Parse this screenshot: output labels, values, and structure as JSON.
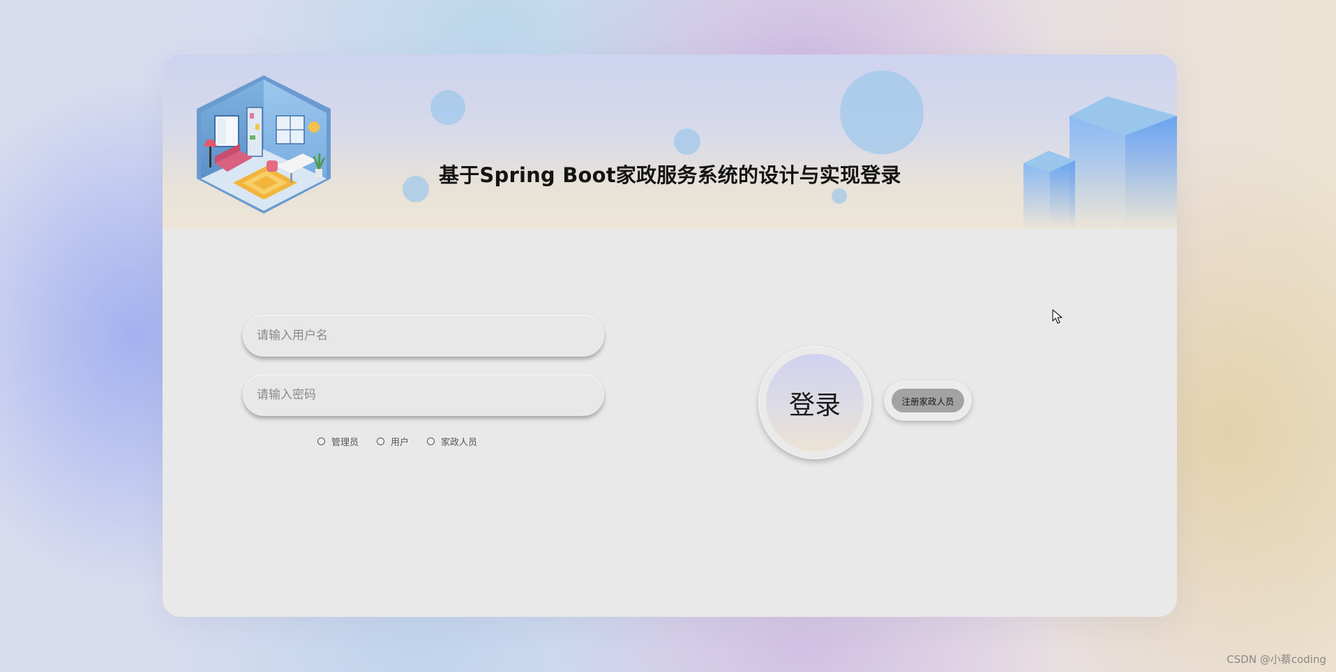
{
  "header": {
    "title": "基于Spring Boot家政服务系统的设计与实现登录"
  },
  "form": {
    "username_placeholder": "请输入用户名",
    "username_value": "",
    "password_placeholder": "请输入密码",
    "password_value": "",
    "roles": [
      {
        "label": "管理员",
        "selected": false
      },
      {
        "label": "用户",
        "selected": false
      },
      {
        "label": "家政人员",
        "selected": false
      }
    ]
  },
  "actions": {
    "login_label": "登录",
    "register_label": "注册家政人员"
  },
  "watermark": "CSDN @小蔡coding",
  "colors": {
    "card_background": "#e9e9e9",
    "register_button": "#a3a3a3",
    "bubble": "#a0c8eb",
    "cube_blue": "#6fa8ee"
  },
  "icons": {
    "illustration": "isometric-room-illustration",
    "decoration": "blue-cubes-decoration",
    "cursor": "mouse-pointer-icon"
  }
}
